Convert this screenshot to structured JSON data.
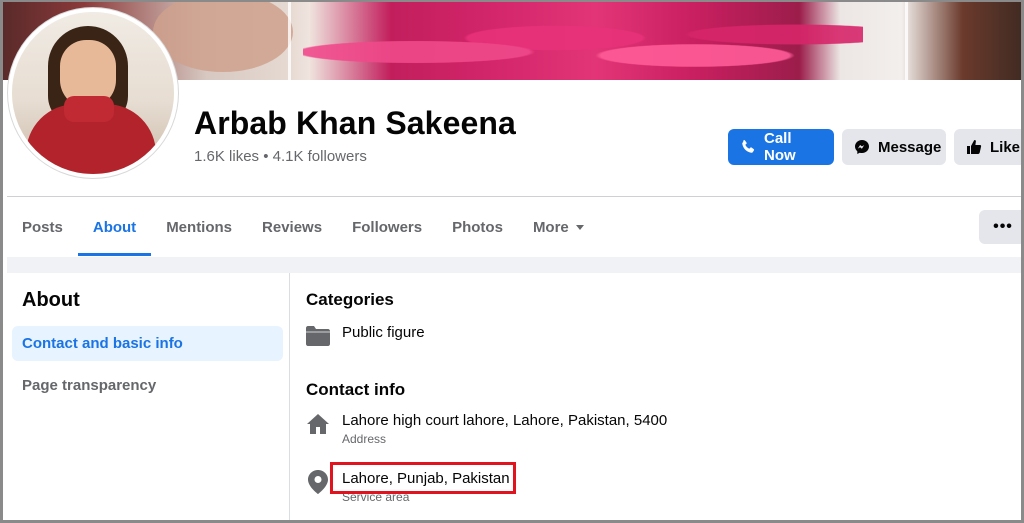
{
  "page": {
    "name": "Arbab Khan Sakeena",
    "stats": "1.6K likes • 4.1K followers"
  },
  "actions": {
    "call_now": "Call Now",
    "message": "Message",
    "like": "Like"
  },
  "tabs": [
    {
      "label": "Posts",
      "active": false
    },
    {
      "label": "About",
      "active": true
    },
    {
      "label": "Mentions",
      "active": false
    },
    {
      "label": "Reviews",
      "active": false
    },
    {
      "label": "Followers",
      "active": false
    },
    {
      "label": "Photos",
      "active": false
    },
    {
      "label": "More",
      "active": false
    }
  ],
  "more_menu_label": "•••",
  "about": {
    "title": "About",
    "nav": [
      {
        "label": "Contact and basic info",
        "active": true
      },
      {
        "label": "Page transparency",
        "active": false
      }
    ]
  },
  "content": {
    "categories_title": "Categories",
    "category": {
      "icon": "folder-icon",
      "value": "Public figure"
    },
    "contact_title": "Contact info",
    "address": {
      "icon": "home-icon",
      "value": "Lahore high court lahore, Lahore, Pakistan, 5400",
      "label": "Address"
    },
    "service_area": {
      "icon": "location-pin-icon",
      "value": "Lahore, Punjab, Pakistan",
      "label": "Service area"
    }
  },
  "colors": {
    "accent": "#1b74e4",
    "highlight_box": "#e0141e",
    "secondary_text": "#65676b",
    "button_grey": "#e4e6eb"
  }
}
